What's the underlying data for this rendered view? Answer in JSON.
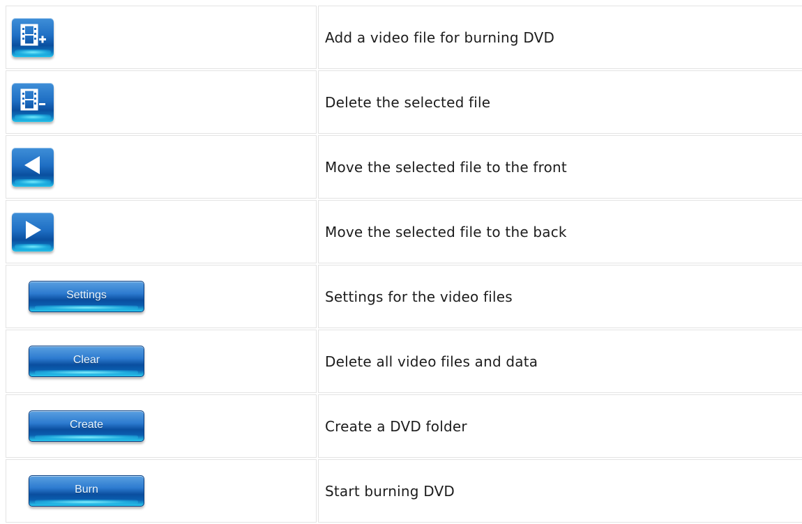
{
  "rows": [
    {
      "control_type": "icon",
      "icon": "film-add-icon",
      "description": "Add a video file for burning DVD"
    },
    {
      "control_type": "icon",
      "icon": "film-remove-icon",
      "description": "Delete the selected file"
    },
    {
      "control_type": "icon",
      "icon": "arrow-left-icon",
      "description": "Move the selected file to the front"
    },
    {
      "control_type": "icon",
      "icon": "arrow-right-icon",
      "description": "Move the selected file to the back"
    },
    {
      "control_type": "text",
      "button_label": "Settings",
      "description": "Settings for the video files"
    },
    {
      "control_type": "text",
      "button_label": "Clear",
      "description": "Delete all video files and data"
    },
    {
      "control_type": "text",
      "button_label": "Create",
      "description": "Create a DVD folder"
    },
    {
      "control_type": "text",
      "button_label": "Burn",
      "description": "Start burning DVD"
    }
  ],
  "colors": {
    "button_top": "#3f8fd8",
    "button_bottom": "#0a4f9f",
    "button_glow": "#24c6ee",
    "grid_border": "#e3e3e3",
    "text": "#1c1c1c"
  }
}
